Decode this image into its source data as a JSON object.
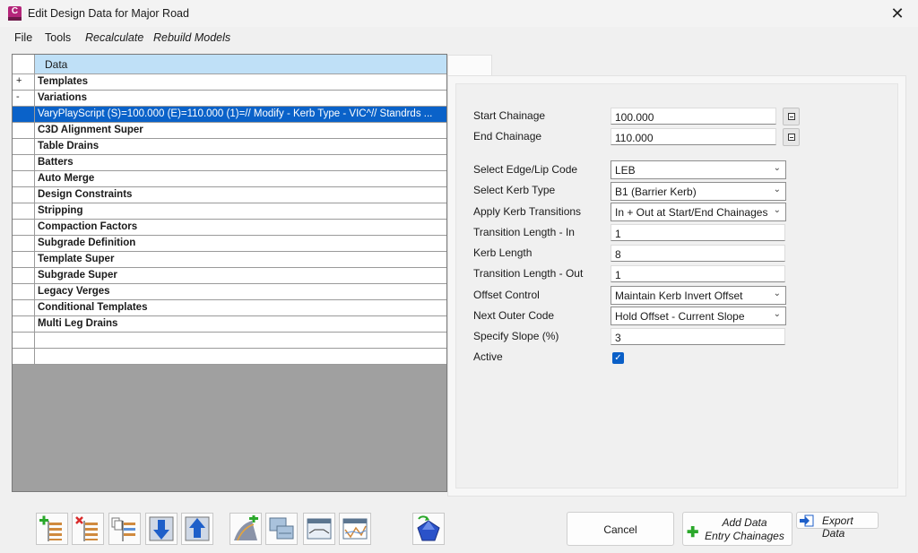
{
  "window": {
    "title": "Edit Design Data for Major Road",
    "app_icon_letter": "C",
    "close_icon": "close-icon"
  },
  "menu": {
    "file": "File",
    "tools": "Tools",
    "recalculate": "Recalculate",
    "rebuild_models": "Rebuild Models"
  },
  "grid": {
    "header": "Data",
    "rows": [
      {
        "marker": "+",
        "text": "Templates"
      },
      {
        "marker": "-",
        "text": "Variations"
      },
      {
        "marker": "",
        "text": "VaryPlayScript (S)=100.000  (E)=110.000  (1)=// Modify - Kerb Type - VIC^// Standrds ...",
        "selected": true
      },
      {
        "marker": "",
        "text": "C3D Alignment Super"
      },
      {
        "marker": "",
        "text": "Table Drains"
      },
      {
        "marker": "",
        "text": "Batters"
      },
      {
        "marker": "",
        "text": "Auto Merge"
      },
      {
        "marker": "",
        "text": "Design Constraints"
      },
      {
        "marker": "",
        "text": "Stripping"
      },
      {
        "marker": "",
        "text": "Compaction Factors"
      },
      {
        "marker": "",
        "text": "Subgrade Definition"
      },
      {
        "marker": "",
        "text": "Template Super"
      },
      {
        "marker": "",
        "text": "Subgrade Super"
      },
      {
        "marker": "",
        "text": "Legacy Verges"
      },
      {
        "marker": "",
        "text": "Conditional Templates"
      },
      {
        "marker": "",
        "text": "Multi Leg Drains"
      },
      {
        "marker": "",
        "text": ""
      },
      {
        "marker": "",
        "text": ""
      }
    ]
  },
  "form": {
    "start_chainage": {
      "label": "Start Chainage",
      "value": "100.000"
    },
    "end_chainage": {
      "label": "End Chainage",
      "value": "110.000"
    },
    "edge_lip_code": {
      "label": "Select Edge/Lip Code",
      "value": "LEB"
    },
    "kerb_type": {
      "label": "Select Kerb Type",
      "value": "B1 (Barrier Kerb)"
    },
    "kerb_transitions": {
      "label": "Apply Kerb Transitions",
      "value": "In + Out at Start/End Chainages"
    },
    "transition_in": {
      "label": "Transition Length - In",
      "value": "1"
    },
    "kerb_length": {
      "label": "Kerb Length",
      "value": "8"
    },
    "transition_out": {
      "label": "Transition Length - Out",
      "value": "1"
    },
    "offset_control": {
      "label": "Offset Control",
      "value": "Maintain Kerb Invert Offset"
    },
    "next_outer_code": {
      "label": "Next Outer Code",
      "value": "Hold Offset - Current Slope"
    },
    "specify_slope": {
      "label": "Specify Slope (%)",
      "value": "3"
    },
    "active": {
      "label": "Active",
      "checked": true,
      "mark": "✓"
    }
  },
  "toolbar": {
    "icons": [
      "add-row-icon",
      "delete-row-icon",
      "copy-row-icon",
      "move-down-icon",
      "move-up-icon",
      "add-alignment-icon",
      "copy-model-icon",
      "section-view-icon",
      "profile-view-icon",
      "render-3d-icon"
    ]
  },
  "buttons": {
    "cancel": "Cancel",
    "add_data_line1": "Add Data",
    "add_data_line2": "Entry Chainages",
    "export_data": "Export Data"
  },
  "colors": {
    "selection": "#0a62c9",
    "header": "#bfe0f7",
    "grid_background": "#a0a0a0",
    "checkbox": "#0a5fc7"
  }
}
